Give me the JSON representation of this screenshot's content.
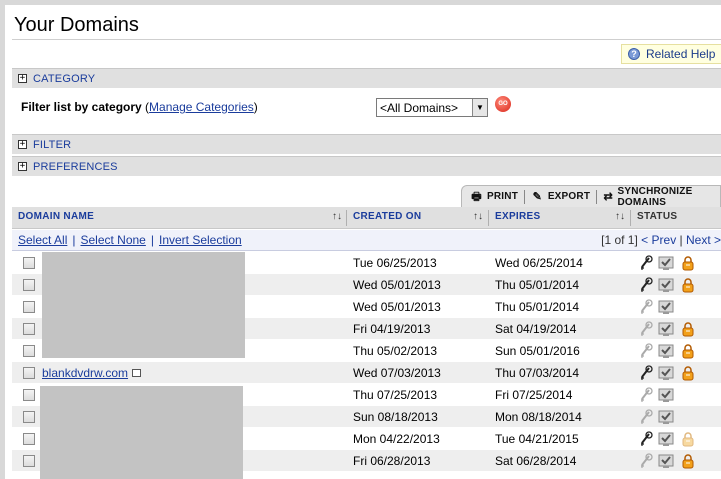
{
  "page": {
    "title": "Your Domains",
    "related_help": "Related Help"
  },
  "sections": {
    "category": "CATEGORY",
    "filter": "FILTER",
    "preferences": "PREFERENCES"
  },
  "category_panel": {
    "label": "Filter list by category",
    "open_paren": "(",
    "manage_link": "Manage Categories",
    "close_paren": ")",
    "select_value": "<All Domains>",
    "go_label": "GO"
  },
  "toolbar": {
    "print": "PRINT",
    "export": "EXPORT",
    "synchronize": "SYNCHRONIZE DOMAINS"
  },
  "grid": {
    "columns": {
      "domain_name": "DOMAIN NAME",
      "created_on": "CREATED ON",
      "expires": "EXPIRES",
      "status": "STATUS",
      "sort_glyph": "↑↓"
    },
    "selection": {
      "select_all": "Select All",
      "select_none": "Select None",
      "invert": "Invert Selection",
      "page_info": "[1 of 1]",
      "prev": "< Prev",
      "next": "Next >"
    },
    "rows": [
      {
        "domain": "",
        "created": "Tue 06/25/2013",
        "expires": "Wed 06/25/2014",
        "status": [
          "active",
          "check",
          "lock"
        ]
      },
      {
        "domain": "",
        "created": "Wed 05/01/2013",
        "expires": "Thu 05/01/2014",
        "status": [
          "active",
          "check",
          "lock"
        ]
      },
      {
        "domain": "",
        "created": "Wed 05/01/2013",
        "expires": "Thu 05/01/2014",
        "status": [
          "inactive",
          "check"
        ]
      },
      {
        "domain": "",
        "created": "Fri 04/19/2013",
        "expires": "Sat 04/19/2014",
        "status": [
          "inactive",
          "check",
          "lock"
        ]
      },
      {
        "domain": "",
        "created": "Thu 05/02/2013",
        "expires": "Sun 05/01/2016",
        "status": [
          "inactive",
          "check",
          "lock"
        ]
      },
      {
        "domain": "blankdvdrw.com",
        "created": "Wed 07/03/2013",
        "expires": "Thu 07/03/2014",
        "status": [
          "active",
          "check",
          "lock"
        ]
      },
      {
        "domain": "",
        "created": "Thu 07/25/2013",
        "expires": "Fri 07/25/2014",
        "status": [
          "inactive",
          "check"
        ]
      },
      {
        "domain": "",
        "created": "Sun 08/18/2013",
        "expires": "Mon 08/18/2014",
        "status": [
          "inactive",
          "check"
        ]
      },
      {
        "domain": "",
        "created": "Mon 04/22/2013",
        "expires": "Tue 04/21/2015",
        "status": [
          "active",
          "check",
          "lock-faded"
        ]
      },
      {
        "domain": "",
        "created": "Fri 06/28/2013",
        "expires": "Sat 06/28/2014",
        "status": [
          "inactive",
          "check",
          "lock"
        ]
      }
    ]
  },
  "colors": {
    "link": "#1a3c9c",
    "section_bg": "#e0e0e0",
    "lock_orange": "#f2a01a"
  }
}
